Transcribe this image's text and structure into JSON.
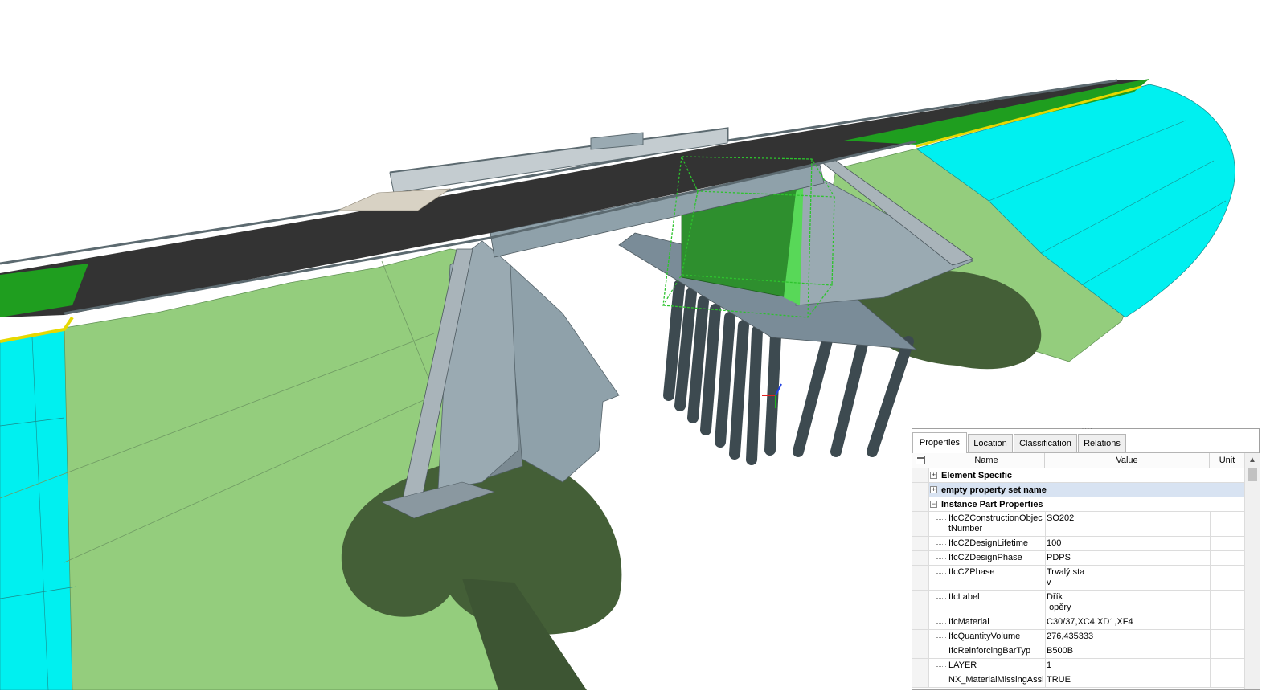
{
  "viewport": {
    "description_icons": [
      "axis-triad-icon"
    ],
    "colors": {
      "terrain": "#94cd7d",
      "slope": "#00f0f0",
      "shadow": "#445f37",
      "concrete": "#8fa1aa",
      "road": "#333333",
      "green_strip": "#1f9e1f",
      "selection": "#2dc32d"
    }
  },
  "panel": {
    "grip": ".....",
    "tabs": [
      {
        "label": "Properties",
        "active": true
      },
      {
        "label": "Location",
        "active": false
      },
      {
        "label": "Classification",
        "active": false
      },
      {
        "label": "Relations",
        "active": false
      }
    ],
    "columns": {
      "name": "Name",
      "value": "Value",
      "unit": "Unit"
    },
    "groups": [
      {
        "label": "Element Specific",
        "expander": "+",
        "selected": false
      },
      {
        "label": "empty property set name",
        "expander": "+",
        "selected": true
      },
      {
        "label": "Instance Part Properties",
        "expander": "−",
        "selected": false
      }
    ],
    "properties": [
      {
        "name": "IfcCZConstructionObjectNumber",
        "value": "SO202"
      },
      {
        "name": "IfcCZDesignLifetime",
        "value": "100"
      },
      {
        "name": "IfcCZDesignPhase",
        "value": "PDPS"
      },
      {
        "name": "IfcCZPhase",
        "value": "Trvalý sta\nv"
      },
      {
        "name": "IfcLabel",
        "value": "Dřík\n opěry"
      },
      {
        "name": "IfcMaterial",
        "value": "C30/37,XC4,XD1,XF4"
      },
      {
        "name": "IfcQuantityVolume",
        "value": "276,435333"
      },
      {
        "name": "IfcReinforcingBarTyp",
        "value": "B500B"
      },
      {
        "name": "LAYER",
        "value": "1"
      },
      {
        "name": "NX_MaterialMissingAssig",
        "value": "TRUE"
      }
    ]
  }
}
